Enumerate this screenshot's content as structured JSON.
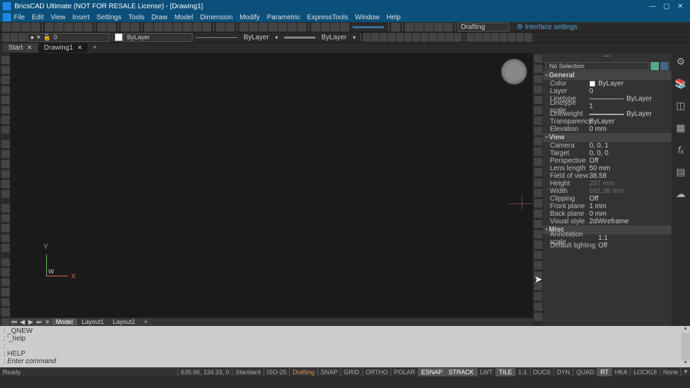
{
  "window": {
    "title": "BricsCAD Ultimate (NOT FOR RESALE License) - [Drawing1]"
  },
  "menu": {
    "items": [
      "File",
      "Edit",
      "View",
      "Insert",
      "Settings",
      "Tools",
      "Draw",
      "Model",
      "Dimension",
      "Modify",
      "Parametric",
      "ExpressTools",
      "Window",
      "Help"
    ]
  },
  "toolbar": {
    "layer_value": "0",
    "bylayer_combo": "ByLayer",
    "linetype_label": "ByLayer",
    "lineweight_label": "ByLayer",
    "workspace": "Drafting",
    "interface_settings": "Interface settings"
  },
  "tabs": {
    "items": [
      {
        "label": "Start",
        "active": false
      },
      {
        "label": "Drawing1",
        "active": true
      }
    ]
  },
  "ucs": {
    "x": "X",
    "y": "Y",
    "w": "W"
  },
  "layouts": {
    "items": [
      "Model",
      "Layout1",
      "Layout2"
    ]
  },
  "properties": {
    "selector": "No Selection",
    "sections": {
      "general": {
        "title": "General",
        "rows": {
          "color_k": "Color",
          "color_v": "ByLayer",
          "layer_k": "Layer",
          "layer_v": "0",
          "linetype_k": "Linetype",
          "linetype_v": "ByLayer",
          "linescale_k": "Linetype scale",
          "linescale_v": "1",
          "lineweight_k": "Lineweight",
          "lineweight_v": "ByLayer",
          "transparency_k": "Transparency",
          "transparency_v": "ByLayer",
          "elevation_k": "Elevation",
          "elevation_v": "0 mm"
        }
      },
      "view": {
        "title": "View",
        "rows": {
          "camera_k": "Camera",
          "camera_v": "0, 0, 1",
          "target_k": "Target",
          "target_v": "0, 0, 0",
          "perspective_k": "Perspective",
          "perspective_v": "Off",
          "lens_k": "Lens length",
          "lens_v": "50 mm",
          "fov_k": "Field of view",
          "fov_v": "38.58",
          "height_k": "Height",
          "height_v": "297 mm",
          "width_k": "Width",
          "width_v": "692.38 mm",
          "clipping_k": "Clipping",
          "clipping_v": "Off",
          "front_k": "Front plane",
          "front_v": "1 mm",
          "back_k": "Back plane",
          "back_v": "0 mm",
          "visual_k": "Visual style",
          "visual_v": "2dWireframe"
        }
      },
      "misc": {
        "title": "Misc",
        "rows": {
          "anno_k": "Annotation scale",
          "anno_v": "1:1",
          "light_k": "Default lighting",
          "light_v": "Off"
        }
      }
    }
  },
  "cmd": {
    "l1": ": _QNEW",
    "l2": ": '_help",
    "l3": ":",
    "l4": ": HELP",
    "l5": ": ",
    "prompt": "Enter command"
  },
  "status": {
    "ready": "Ready",
    "coords": "635.96, 134.33, 0",
    "cells": [
      "Standard",
      "ISO-25",
      "Drafting",
      "SNAP",
      "GRID",
      "ORTHO",
      "POLAR",
      "ESNAP",
      "STRACK",
      "LWT",
      "TILE",
      "1:1",
      "DUCS",
      "DYN",
      "QUAD",
      "RT",
      "HKA",
      "LOCKUI",
      "None"
    ]
  },
  "status_on": {
    "ESNAP": true,
    "STRACK": true,
    "TILE": true,
    "RT": true
  },
  "status_hl": {
    "Drafting": true
  }
}
